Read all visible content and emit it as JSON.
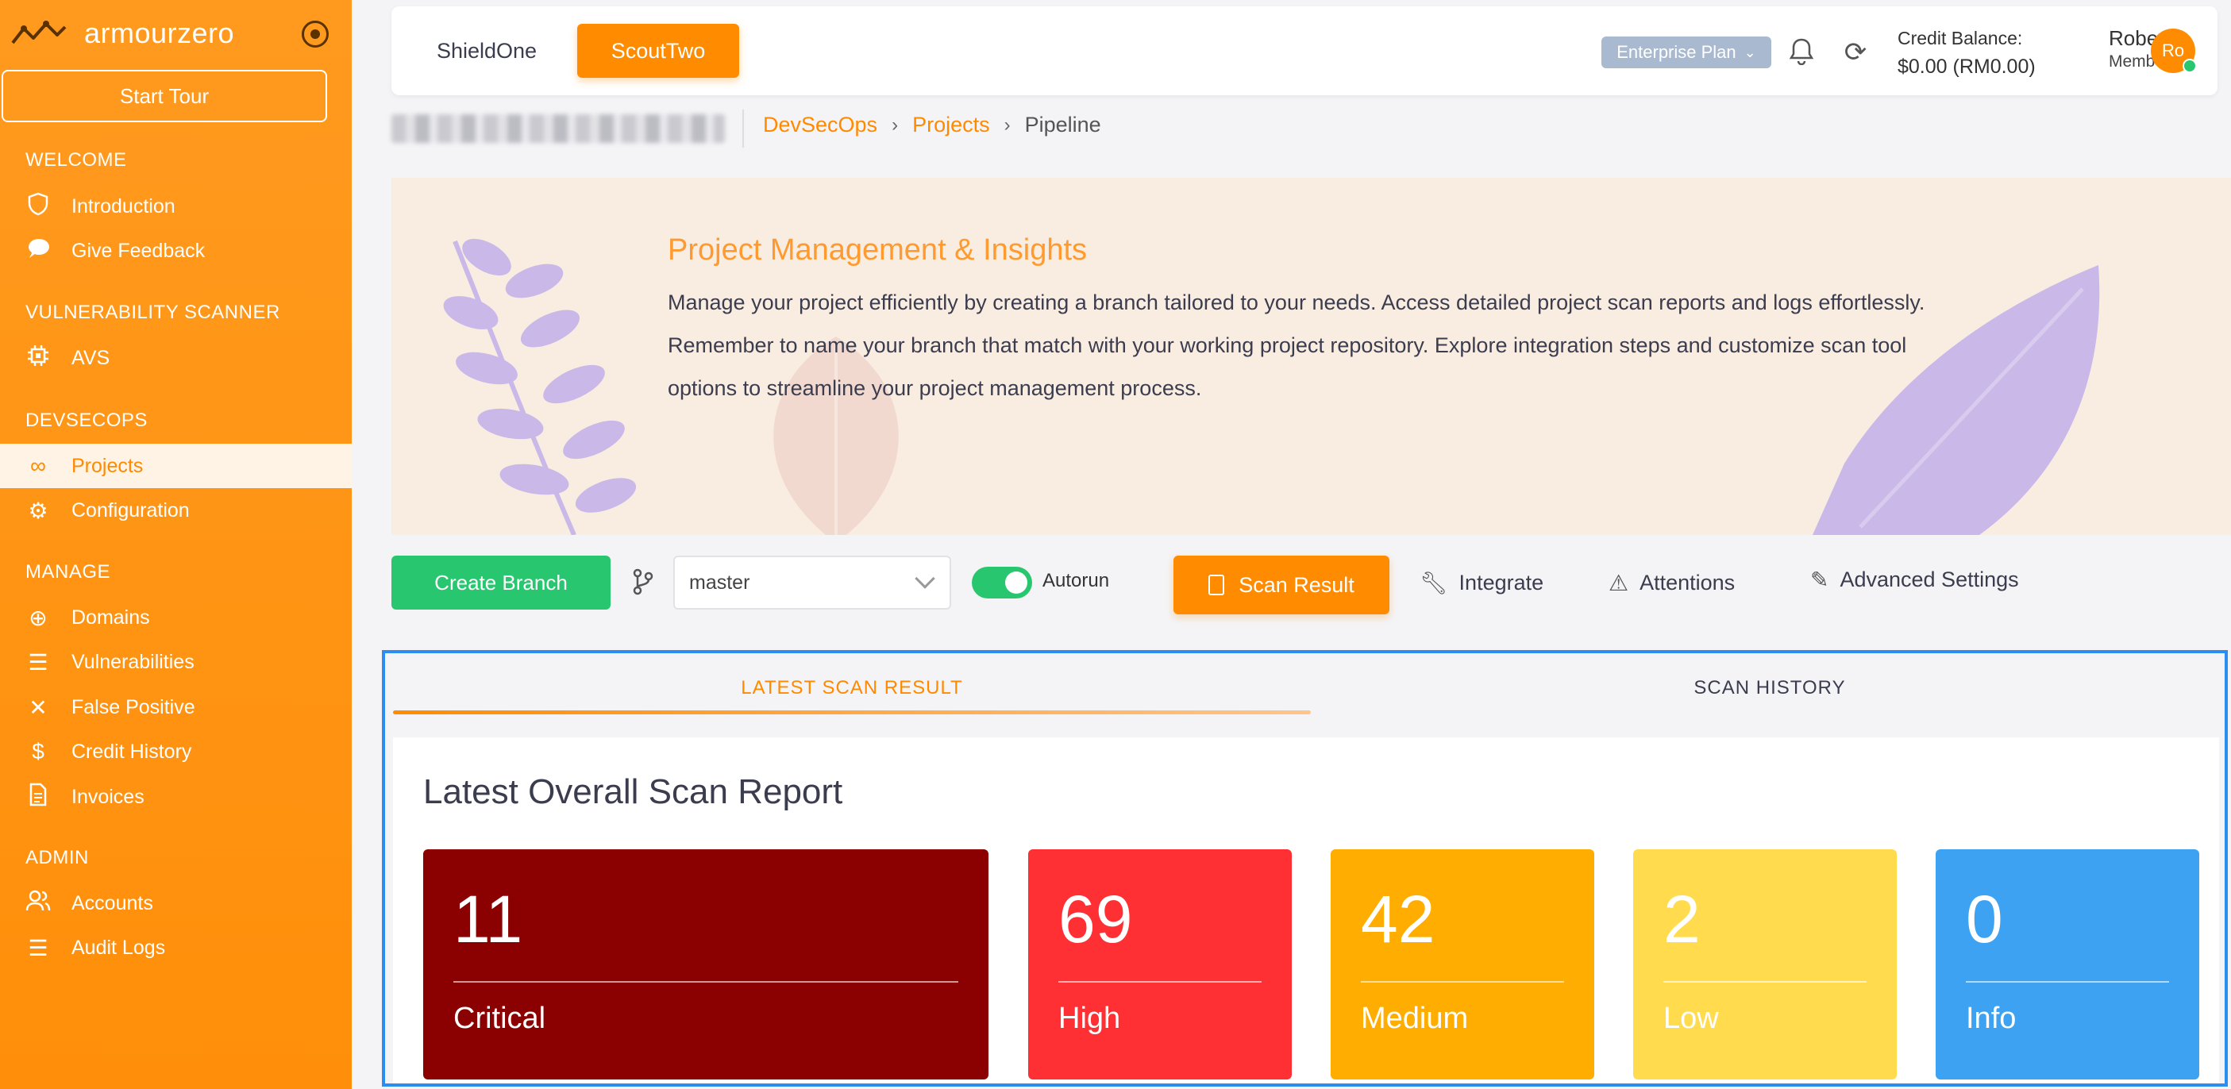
{
  "brand": {
    "name": "armourzero",
    "start_tour": "Start Tour"
  },
  "sidebar": {
    "sections": [
      {
        "title": "WELCOME",
        "items": [
          {
            "label": "Introduction",
            "icon": "shield-icon"
          },
          {
            "label": "Give Feedback",
            "icon": "chat-bubble-icon"
          }
        ]
      },
      {
        "title": "VULNERABILITY SCANNER",
        "items": [
          {
            "label": "AVS",
            "icon": "chip-icon"
          }
        ]
      },
      {
        "title": "DEVSECOPS",
        "items": [
          {
            "label": "Projects",
            "icon": "infinity-icon",
            "active": true
          },
          {
            "label": "Configuration",
            "icon": "gear-icon"
          }
        ]
      },
      {
        "title": "MANAGE",
        "items": [
          {
            "label": "Domains",
            "icon": "plus-circle-icon"
          },
          {
            "label": "Vulnerabilities",
            "icon": "checklist-icon"
          },
          {
            "label": "False Positive",
            "icon": "x-icon"
          },
          {
            "label": "Credit History",
            "icon": "dollar-icon"
          },
          {
            "label": "Invoices",
            "icon": "document-icon"
          }
        ]
      },
      {
        "title": "ADMIN",
        "items": [
          {
            "label": "Accounts",
            "icon": "users-icon"
          },
          {
            "label": "Audit Logs",
            "icon": "list-icon"
          }
        ]
      }
    ]
  },
  "header": {
    "tabs": [
      "ShieldOne",
      "ScoutTwo"
    ],
    "active_tab": "ScoutTwo",
    "plan": "Enterprise Plan",
    "credit_label": "Credit Balance:",
    "credit_value": "$0.00 (RM0.00)",
    "user_name": "Robert",
    "user_role": "Member",
    "avatar_initials": "Ro"
  },
  "breadcrumb": {
    "items": [
      "DevSecOps",
      "Projects"
    ],
    "current": "Pipeline"
  },
  "banner": {
    "title": "Project Management & Insights",
    "text": "Manage your project efficiently by creating a branch tailored to your needs. Access detailed project scan reports and logs effortlessly. Remember to name your branch that match with your working project repository. Explore integration steps and customize scan tool options to streamline your project management process."
  },
  "toolbar": {
    "create_branch": "Create Branch",
    "branch": "master",
    "autorun_label": "Autorun",
    "autorun_on": true,
    "scan_result": "Scan Result",
    "integrate": "Integrate",
    "attentions": "Attentions",
    "advanced_settings": "Advanced Settings"
  },
  "results": {
    "tabs": [
      "LATEST SCAN RESULT",
      "SCAN HISTORY"
    ],
    "report_title": "Latest Overall Scan Report",
    "severities": [
      {
        "label": "Critical",
        "count": "11",
        "color": "#8b0000"
      },
      {
        "label": "High",
        "count": "69",
        "color": "#ff3033"
      },
      {
        "label": "Medium",
        "count": "42",
        "color": "#ffad00"
      },
      {
        "label": "Low",
        "count": "2",
        "color": "#ffdb4d"
      },
      {
        "label": "Info",
        "count": "0",
        "color": "#3da2f2"
      }
    ]
  },
  "colors": {
    "accent": "#ff8c00",
    "sidebar": "#ff9617",
    "success": "#28c76f",
    "selection": "#2b8cf2"
  }
}
